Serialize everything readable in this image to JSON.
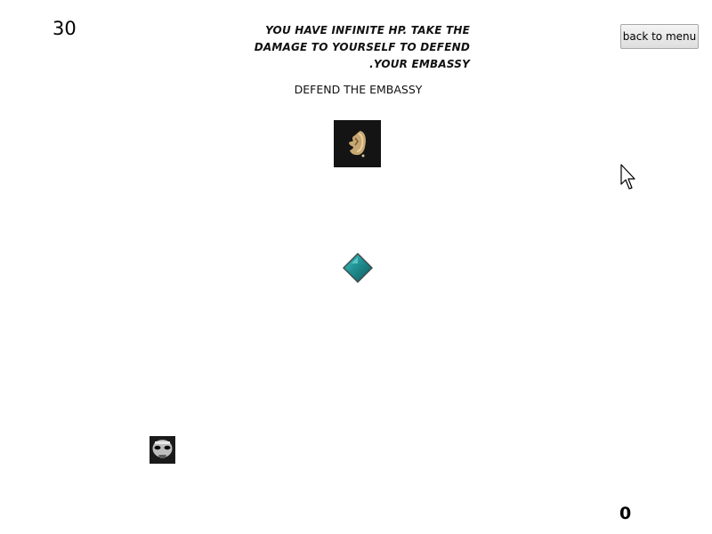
{
  "game": {
    "timer": "30",
    "score": "0",
    "instructions": [
      "YOU HAVE INFINITE HP. TAKE THE",
      "DAMAGE TO YOURSELF TO DEFEND",
      ".YOUR EMBASSY"
    ],
    "heading": "DEFEND THE EMBASSY"
  },
  "controls": {
    "back_label": "back to menu"
  },
  "sprites": {
    "enemy": "enemy-sprite",
    "embassy": "embassy-diamond",
    "player": "player-sprite",
    "cursor": "mouse-cursor"
  },
  "colors": {
    "background": "#ffffff",
    "embassy": "#1e8a8c",
    "button": "#e2e2e2"
  }
}
